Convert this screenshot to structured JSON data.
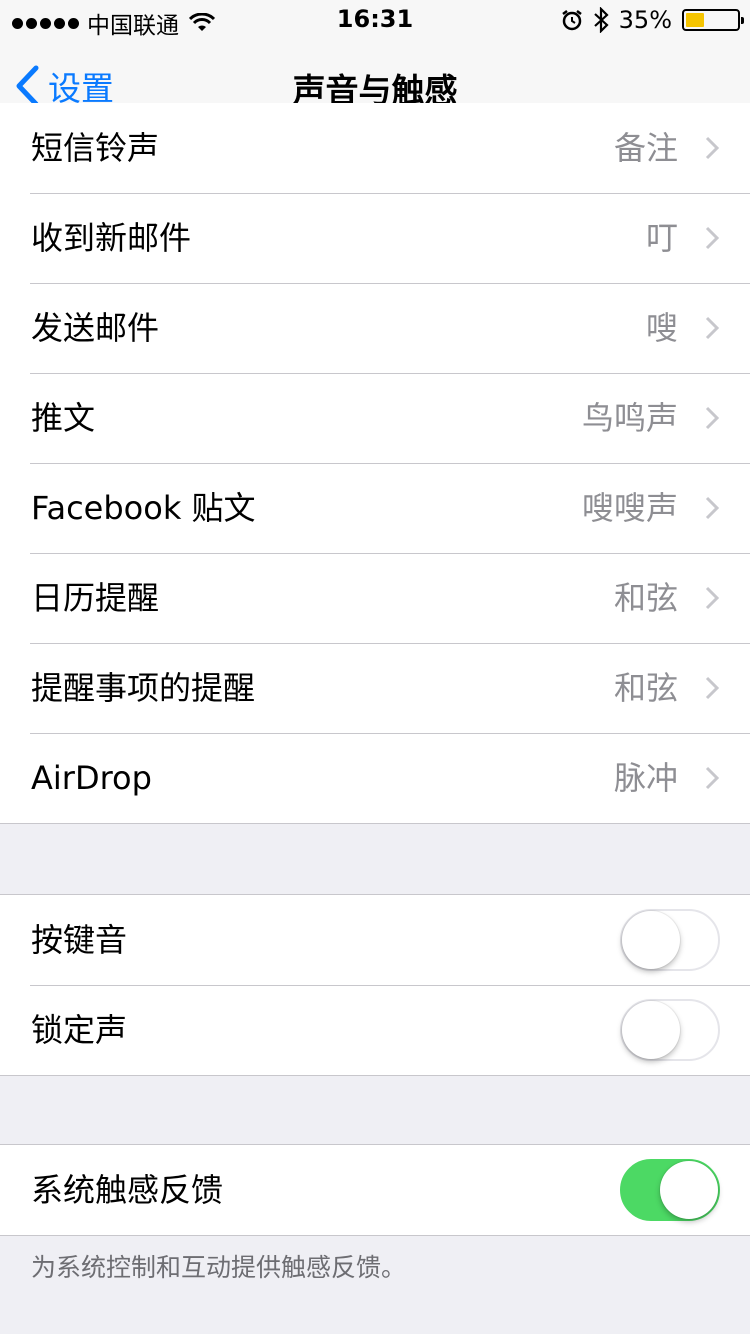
{
  "status_bar": {
    "carrier": "中国联通",
    "time": "16:31",
    "battery_percent": "35%",
    "battery_level": 0.35,
    "battery_color": "#f5c400"
  },
  "nav": {
    "back_label": "设置",
    "title": "声音与触感",
    "accent_color": "#0a7aff"
  },
  "sounds": [
    {
      "label": "短信铃声",
      "value": "备注"
    },
    {
      "label": "收到新邮件",
      "value": "叮"
    },
    {
      "label": "发送邮件",
      "value": "嗖"
    },
    {
      "label": "推文",
      "value": "鸟鸣声"
    },
    {
      "label": "Facebook 贴文",
      "value": "嗖嗖声"
    },
    {
      "label": "日历提醒",
      "value": "和弦"
    },
    {
      "label": "提醒事项的提醒",
      "value": "和弦"
    },
    {
      "label": "AirDrop",
      "value": "脉冲"
    }
  ],
  "toggles": [
    {
      "label": "按键音",
      "on": false
    },
    {
      "label": "锁定声",
      "on": false
    }
  ],
  "haptics": {
    "label": "系统触感反馈",
    "on": true,
    "footer": "为系统控制和互动提供触感反馈。",
    "switch_on_color": "#4cd964"
  }
}
